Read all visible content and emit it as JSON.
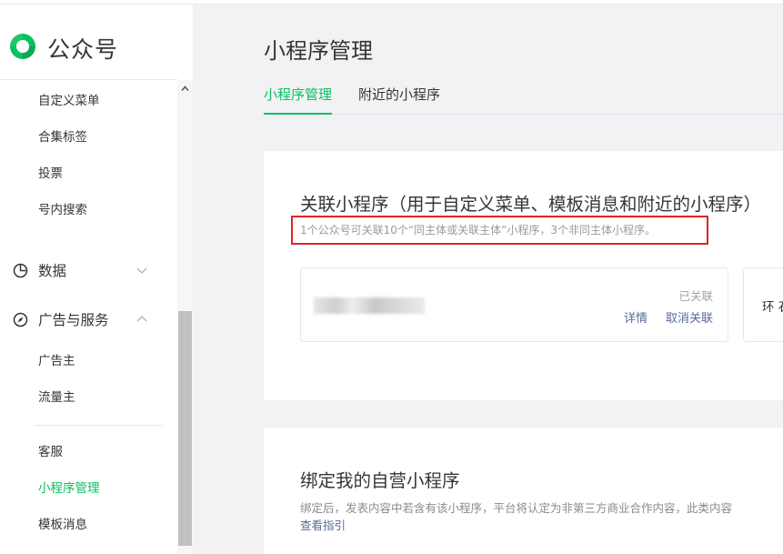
{
  "brand": {
    "name": "公众号"
  },
  "sidebar": {
    "sub_items_top": [
      {
        "label": "自定义菜单"
      },
      {
        "label": "合集标签"
      },
      {
        "label": "投票"
      },
      {
        "label": "号内搜索"
      }
    ],
    "groups": [
      {
        "label": "数据",
        "icon": "pie-chart-icon",
        "expanded": false
      },
      {
        "label": "广告与服务",
        "icon": "compass-icon",
        "expanded": true
      }
    ],
    "ad_items": [
      {
        "label": "广告主"
      },
      {
        "label": "流量主"
      }
    ],
    "service_items": [
      {
        "label": "客服",
        "active": false
      },
      {
        "label": "小程序管理",
        "active": true
      },
      {
        "label": "模板消息",
        "active": false
      }
    ]
  },
  "main": {
    "page_title": "小程序管理",
    "tabs": [
      {
        "label": "小程序管理",
        "active": true
      },
      {
        "label": "附近的小程序",
        "active": false
      }
    ],
    "linked_section": {
      "title": "关联小程序（用于自定义菜单、模板消息和附近的小程序）",
      "description": "1个公众号可关联10个“同主体或关联主体”小程序，3个非同主体小程序。",
      "miniprogram": {
        "status": "已关联",
        "detail_link": "详情",
        "unlink_link": "取消关联"
      },
      "second_card_text": "环 石"
    },
    "bind_section": {
      "title": "绑定我的自营小程序",
      "description": "绑定后，发表内容中若含有该小程序，平台将认定为非第三方商业合作内容，此类内容",
      "guide_link": "查看指引"
    }
  },
  "colors": {
    "accent": "#07c160",
    "link": "#576b95",
    "highlight_border": "#e02424"
  }
}
